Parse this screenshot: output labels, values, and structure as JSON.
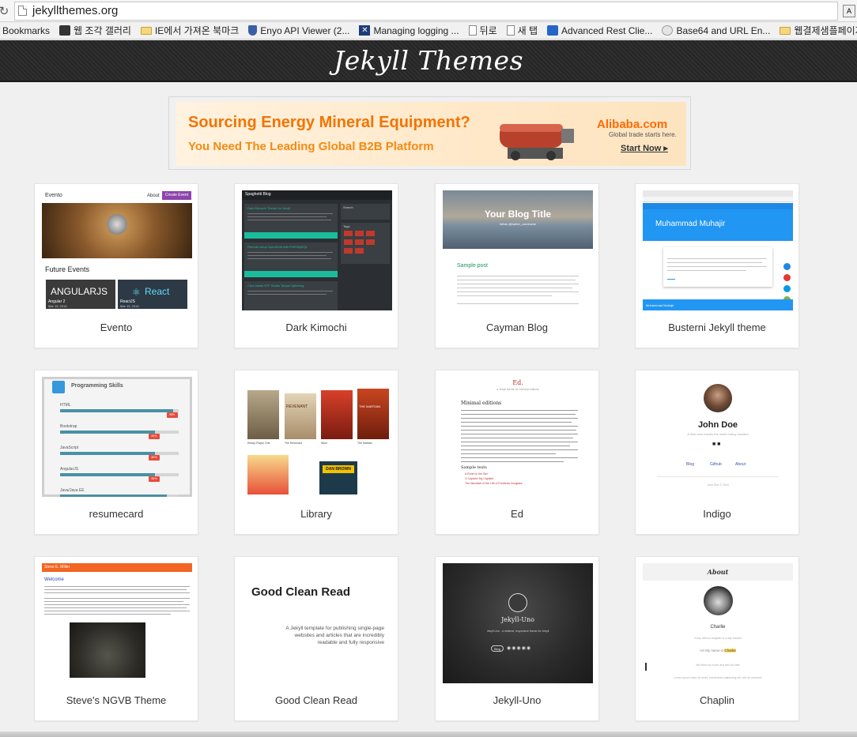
{
  "browser": {
    "url": "jekyllthemes.org",
    "bookmarks": [
      {
        "label": "Bookmarks",
        "icon": "none"
      },
      {
        "label": "웹 조각 갤러리",
        "icon": "dark-app-icon"
      },
      {
        "label": "IE에서 가져온 북마크",
        "icon": "folder-icon"
      },
      {
        "label": "Enyo API Viewer (2...",
        "icon": "shield-icon"
      },
      {
        "label": "Managing logging ...",
        "icon": "x-logo-icon"
      },
      {
        "label": "뒤로",
        "icon": "page-icon"
      },
      {
        "label": "새 탭",
        "icon": "page-icon"
      },
      {
        "label": "Advanced Rest Clie...",
        "icon": "upload-icon"
      },
      {
        "label": "Base64 and URL En...",
        "icon": "b64-icon"
      },
      {
        "label": "웹결제샘플페이지",
        "icon": "folder-icon"
      }
    ]
  },
  "site": {
    "title": "Jekyll Themes"
  },
  "ad": {
    "headline": "Sourcing Energy Mineral Equipment?",
    "subline": "You Need The Leading Global B2B Platform",
    "brand": "Alibaba.com",
    "brand_tagline": "Global trade starts here.",
    "cta": "Start Now ▸"
  },
  "themes": [
    {
      "label": "Evento",
      "thumb": {
        "brand": "Evento",
        "nav1": "About",
        "nav2": "Create Event",
        "heading": "Future Events",
        "event1": "Angular 2",
        "event1_date": "Mar 15, 2016",
        "event2": "ReactJS",
        "event2_date": "Mar 15, 2016",
        "logo1": "ANGULARJS",
        "logo2": "React"
      }
    },
    {
      "label": "Dark Kimochi",
      "thumb": {
        "brand": "Spaghetti Blog",
        "post1": "Dark Kimochi Theme for Jekyll",
        "post2": "Remote setup OpenShift with PHP/MySQL",
        "post3": "Cara install STF Studio Tanpa Ciphering",
        "tags": "Tags",
        "search": "Search"
      }
    },
    {
      "label": "Cayman Blog",
      "thumb": {
        "title": "Your Blog Title",
        "subtitle": "follow @twitter_username",
        "post_title": "Sample post"
      }
    },
    {
      "label": "Busterni Jekyll theme",
      "thumb": {
        "name": "Muhammad Muhajir",
        "footer_name": "Muhammad Muhajir"
      }
    },
    {
      "label": "resumecard",
      "thumb": {
        "title": "Programming Skills",
        "skills": [
          {
            "name": "HTML",
            "pct": "95%",
            "value": 0.95
          },
          {
            "name": "Bootstrap",
            "pct": "80%",
            "value": 0.8
          },
          {
            "name": "JavaScript",
            "pct": "80%",
            "value": 0.8
          },
          {
            "name": "AngularJS",
            "pct": "80%",
            "value": 0.8
          },
          {
            "name": "Java/Java EE",
            "pct": "90%",
            "value": 0.9
          }
        ]
      }
    },
    {
      "label": "Library",
      "thumb": {
        "book1": "Ready Player One",
        "book2": "The Revenant",
        "book3": "Wool",
        "book4": "The Martian",
        "cover_revenant": "REVENANT",
        "cover_martian": "THE MARTIAN",
        "cover_danbrown": "DAN BROWN"
      }
    },
    {
      "label": "Ed",
      "thumb": {
        "logo": "Ed.",
        "tagline": "a Jekyll theme for minimal editions",
        "heading": "Minimal editions",
        "sample": "Sample texts",
        "link1": "A Room in the Sun",
        "link2": "O Captain! My Captain!",
        "link3": "The Narrative of the Life of Frederick Douglass"
      }
    },
    {
      "label": "Indigo",
      "thumb": {
        "name": "John Doe",
        "bio": "A Man who travels the world eating noodles",
        "nav1": "Blog",
        "nav2": "Github",
        "nav3": "About",
        "footer": "John Doe © 2015"
      }
    },
    {
      "label": "Steve's NGVB Theme",
      "thumb": {
        "brand": "Steve E. Miller",
        "heading": "Welcome"
      }
    },
    {
      "label": "Good Clean Read",
      "thumb": {
        "title": "Good Clean Read",
        "line1": "A Jekyll template for publishing single-page",
        "line2": "websites and articles that are incredibly",
        "line3": "readable and fully responsive"
      }
    },
    {
      "label": "Jekyll-Uno",
      "thumb": {
        "title": "Jekyll-Uno",
        "tagline": "Jekyll Uno - a minimal, responsive theme for Jekyll",
        "btn": "Blog"
      }
    },
    {
      "label": "Chaplin",
      "thumb": {
        "heading": "About",
        "name": "Charlie",
        "caption": "A boy without laughter is a day wasted",
        "greeting_prefix": "Hi! My name is",
        "greeting_name": "Charlie",
        "line2": "We think too much and feel too little",
        "lorem": "Lorem ipsum dolor sit amet, consectetur adipiscing elit, sed do eiusmod"
      }
    }
  ],
  "colors": {
    "header_bg": "#2b2b2b",
    "ad_orange": "#f27400",
    "evento_purple": "#8e44ad",
    "busterni_blue": "#2196f3",
    "resume_red": "#e74c3c",
    "ngvb_orange": "#f26522"
  }
}
